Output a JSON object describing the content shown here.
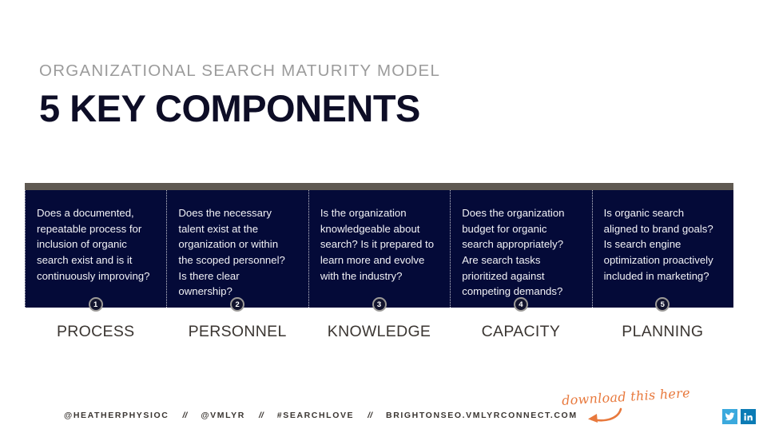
{
  "slide": {
    "eyebrow": "ORGANIZATIONAL SEARCH MATURITY MODEL",
    "headline": "5 KEY COMPONENTS"
  },
  "colors": {
    "panel_navy": "#040a38",
    "panel_topbar": "#5f5952",
    "eyebrow_grey": "#9b9b9b",
    "headline_navy": "#0d0d26",
    "accent_orange": "#e8793d",
    "label_brown": "#3b3632",
    "twitter_blue": "#3ba9dd",
    "linkedin_blue": "#0b7bb5"
  },
  "components": [
    {
      "number": "1",
      "label": "PROCESS",
      "question": "Does a documented, repeatable process for inclusion of organic search exist and is it continuously improving?"
    },
    {
      "number": "2",
      "label": "PERSONNEL",
      "question": "Does the necessary talent exist at the organization or within the scoped personnel? Is there clear ownership?"
    },
    {
      "number": "3",
      "label": "KNOWLEDGE",
      "question": "Is the organization knowledgeable about search? Is it prepared to learn more and evolve with the industry?"
    },
    {
      "number": "4",
      "label": "CAPACITY",
      "question": "Does the organization budget for organic search appropriately? Are search tasks prioritized against competing demands?"
    },
    {
      "number": "5",
      "label": "PLANNING",
      "question": "Is organic search aligned to brand goals? Is search engine optimization proactively included in marketing?"
    }
  ],
  "footer": {
    "items": [
      "@HEATHERPHYSIOC",
      "@VMLYR",
      "#SEARCHLOVE",
      "BRIGHTONSEO.VMLYRCONNECT.COM"
    ],
    "separator": "//",
    "script_note": "download this here",
    "social": [
      {
        "name": "twitter",
        "glyph": "✔"
      },
      {
        "name": "linkedin",
        "glyph": "in"
      }
    ]
  }
}
